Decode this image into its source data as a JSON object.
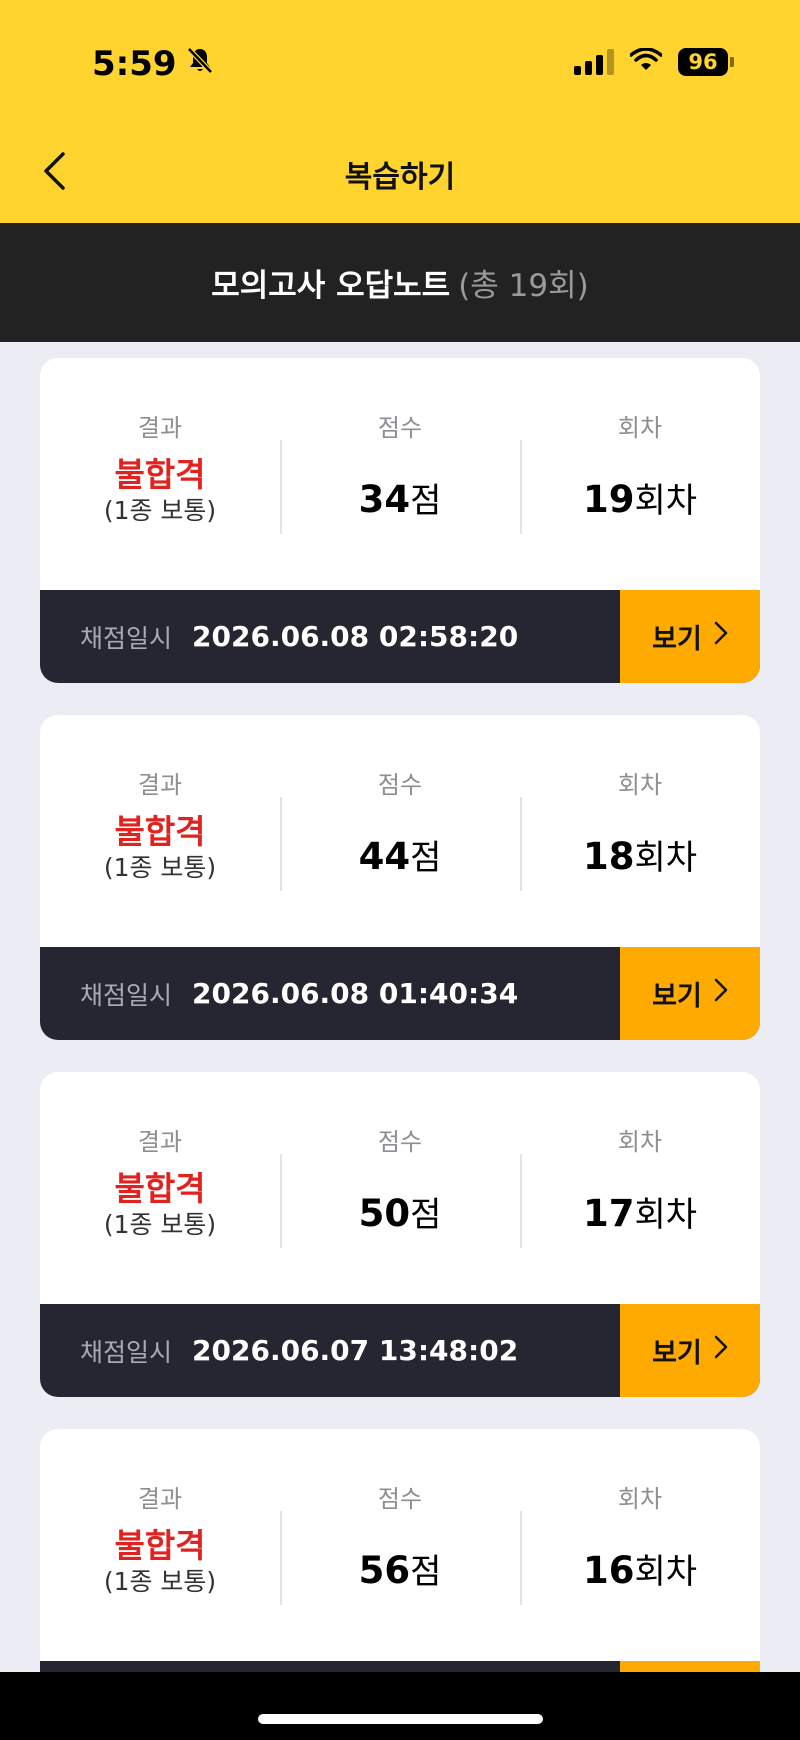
{
  "status": {
    "time": "5:59",
    "battery": "96",
    "icons": [
      "bell-slash-icon",
      "signal-icon",
      "wifi-icon",
      "battery-icon"
    ]
  },
  "header": {
    "title": "복습하기",
    "back_icon": "chevron-left-icon"
  },
  "banner": {
    "title": "모의고사 오답노트",
    "count": "(총 19회)"
  },
  "labels": {
    "result": "결과",
    "score": "점수",
    "round": "회차",
    "date_label": "채점일시",
    "view": "보기",
    "score_unit": "점",
    "round_unit": "회차"
  },
  "records": [
    {
      "result": "불합격",
      "license": "(1종 보통)",
      "score": "34",
      "round": "19",
      "date": "2026.06.08 02:58:20"
    },
    {
      "result": "불합격",
      "license": "(1종 보통)",
      "score": "44",
      "round": "18",
      "date": "2026.06.08 01:40:34"
    },
    {
      "result": "불합격",
      "license": "(1종 보통)",
      "score": "50",
      "round": "17",
      "date": "2026.06.07 13:48:02"
    },
    {
      "result": "불합격",
      "license": "(1종 보통)",
      "score": "56",
      "round": "16",
      "date": ""
    }
  ],
  "colors": {
    "header_bg": "#FFD42E",
    "banner_bg": "#222222",
    "fail_text": "#E0231F",
    "footer_bg": "#262632",
    "button_bg": "#FFAA00"
  }
}
